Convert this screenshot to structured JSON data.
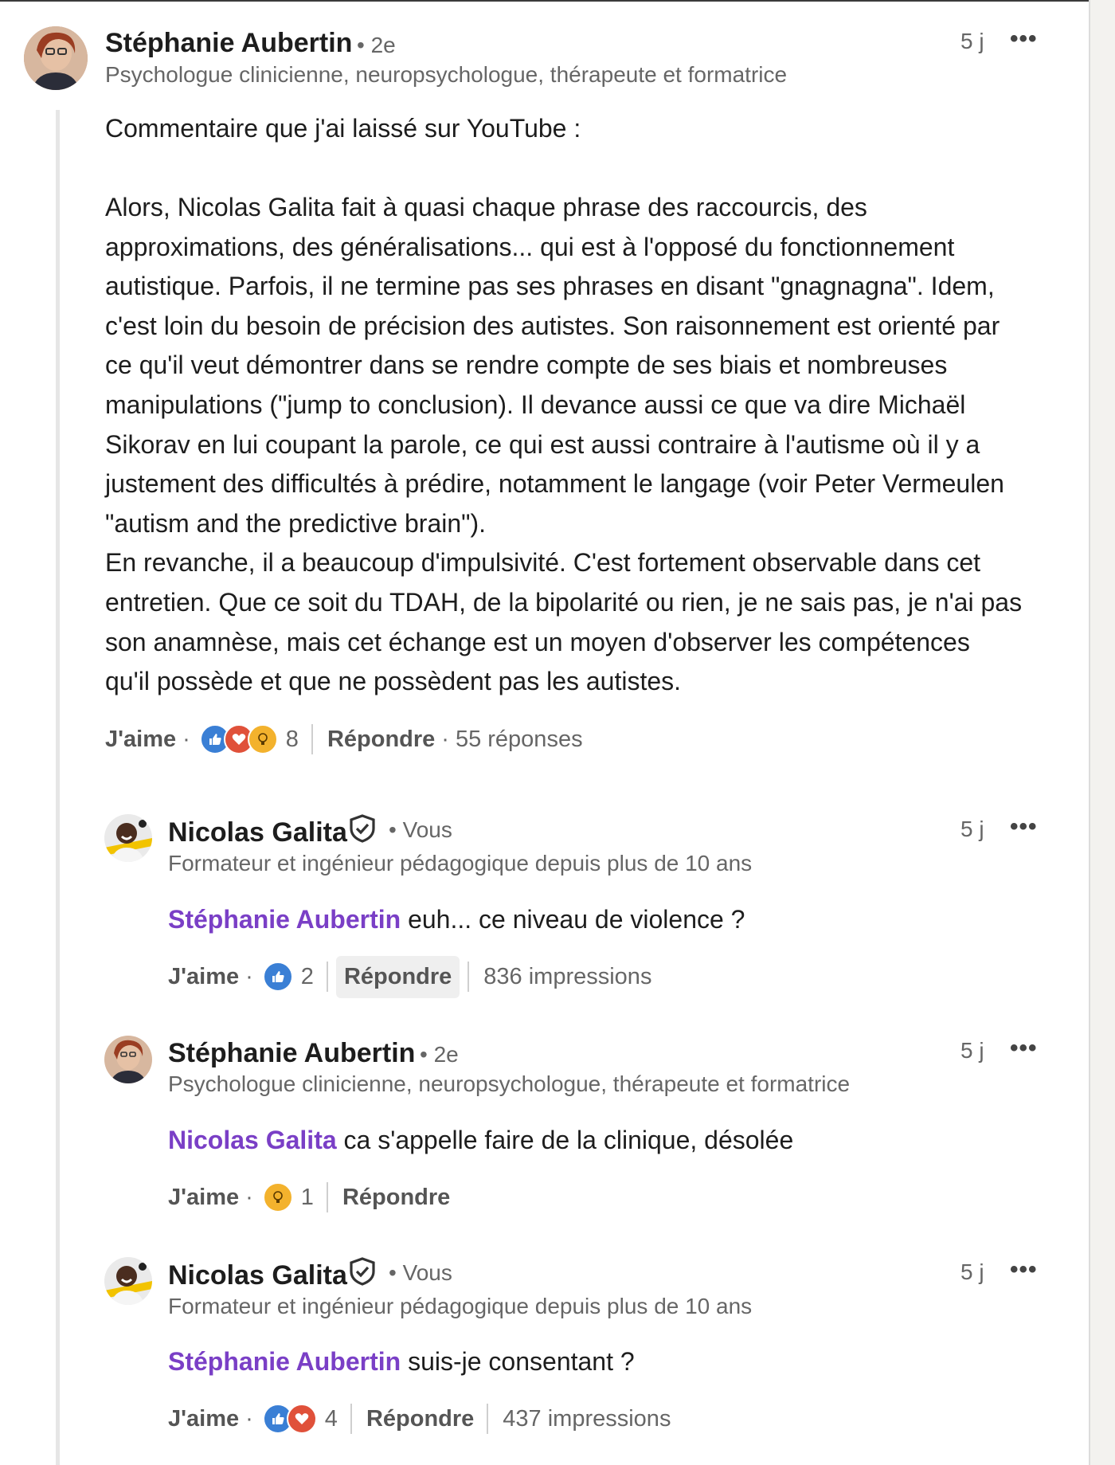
{
  "comment_main": {
    "author": "Stéphanie Aubertin",
    "degree": "• 2e",
    "headline": "Psychologue clinicienne, neuropsychologue, thérapeute et formatrice",
    "time": "5 j",
    "more": "•••",
    "text_intro": "Commentaire que j'ai laissé sur YouTube :",
    "text_body": "Alors, Nicolas Galita fait à quasi chaque phrase des raccourcis, des\napproximations, des généralisations... qui est à l'opposé du fonctionnement\nautistique. Parfois, il ne termine pas ses phrases en disant \"gnagnagna\". Idem,\nc'est loin du besoin de précision des autistes. Son raisonnement est orienté par\nce qu'il veut démontrer dans se rendre compte de ses biais et nombreuses\nmanipulations (\"jump to conclusion). Il devance aussi ce que va dire Michaël\nSikorav en lui coupant la parole, ce qui est aussi contraire à l'autisme où il y a\njustement des difficultés à prédire, notamment le langage (voir Peter Vermeulen\n\"autism and the predictive brain\").\nEn revanche, il a beaucoup d'impulsivité. C'est fortement observable dans cet\nentretien. Que ce soit du TDAH, de la bipolarité ou rien, je ne sais pas, je n'ai pas\nson anamnèse, mais cet échange est un moyen d'observer les compétences\nqu'il possède et que ne possèdent pas les autistes.",
    "like_label": "J'aime",
    "reaction_count": "8",
    "reactions": [
      "like-icon",
      "love-icon",
      "idea-icon"
    ],
    "reply_label": "Répondre",
    "replies": "55 réponses"
  },
  "reply1": {
    "author": "Nicolas Galita",
    "degree": "• Vous",
    "headline": "Formateur et ingénieur pédagogique depuis plus de 10 ans",
    "time": "5 j",
    "more": "•••",
    "mention": "Stéphanie Aubertin",
    "text": " euh... ce niveau de violence ?",
    "like_label": "J'aime",
    "reaction_count": "2",
    "reactions": [
      "like-icon"
    ],
    "reply_label": "Répondre",
    "impressions": "836 impressions"
  },
  "reply2": {
    "author": "Stéphanie Aubertin",
    "degree": "• 2e",
    "headline": "Psychologue clinicienne, neuropsychologue, thérapeute et formatrice",
    "time": "5 j",
    "more": "•••",
    "mention": "Nicolas Galita",
    "text": " ca s'appelle faire de la clinique, désolée",
    "like_label": "J'aime",
    "reaction_count": "1",
    "reactions": [
      "idea-icon"
    ],
    "reply_label": "Répondre"
  },
  "reply3": {
    "author": "Nicolas Galita",
    "degree": "• Vous",
    "headline": "Formateur et ingénieur pédagogique depuis plus de 10 ans",
    "time": "5 j",
    "more": "•••",
    "mention": "Stéphanie Aubertin",
    "text": " suis-je consentant ?",
    "like_label": "J'aime",
    "reaction_count": "4",
    "reactions": [
      "like-icon",
      "love-icon"
    ],
    "reply_label": "Répondre",
    "impressions": "437 impressions"
  },
  "colors": {
    "mention": "#7a3fc6",
    "like": "#3a7fd5",
    "love": "#e0513a",
    "idea": "#f3b22d"
  }
}
